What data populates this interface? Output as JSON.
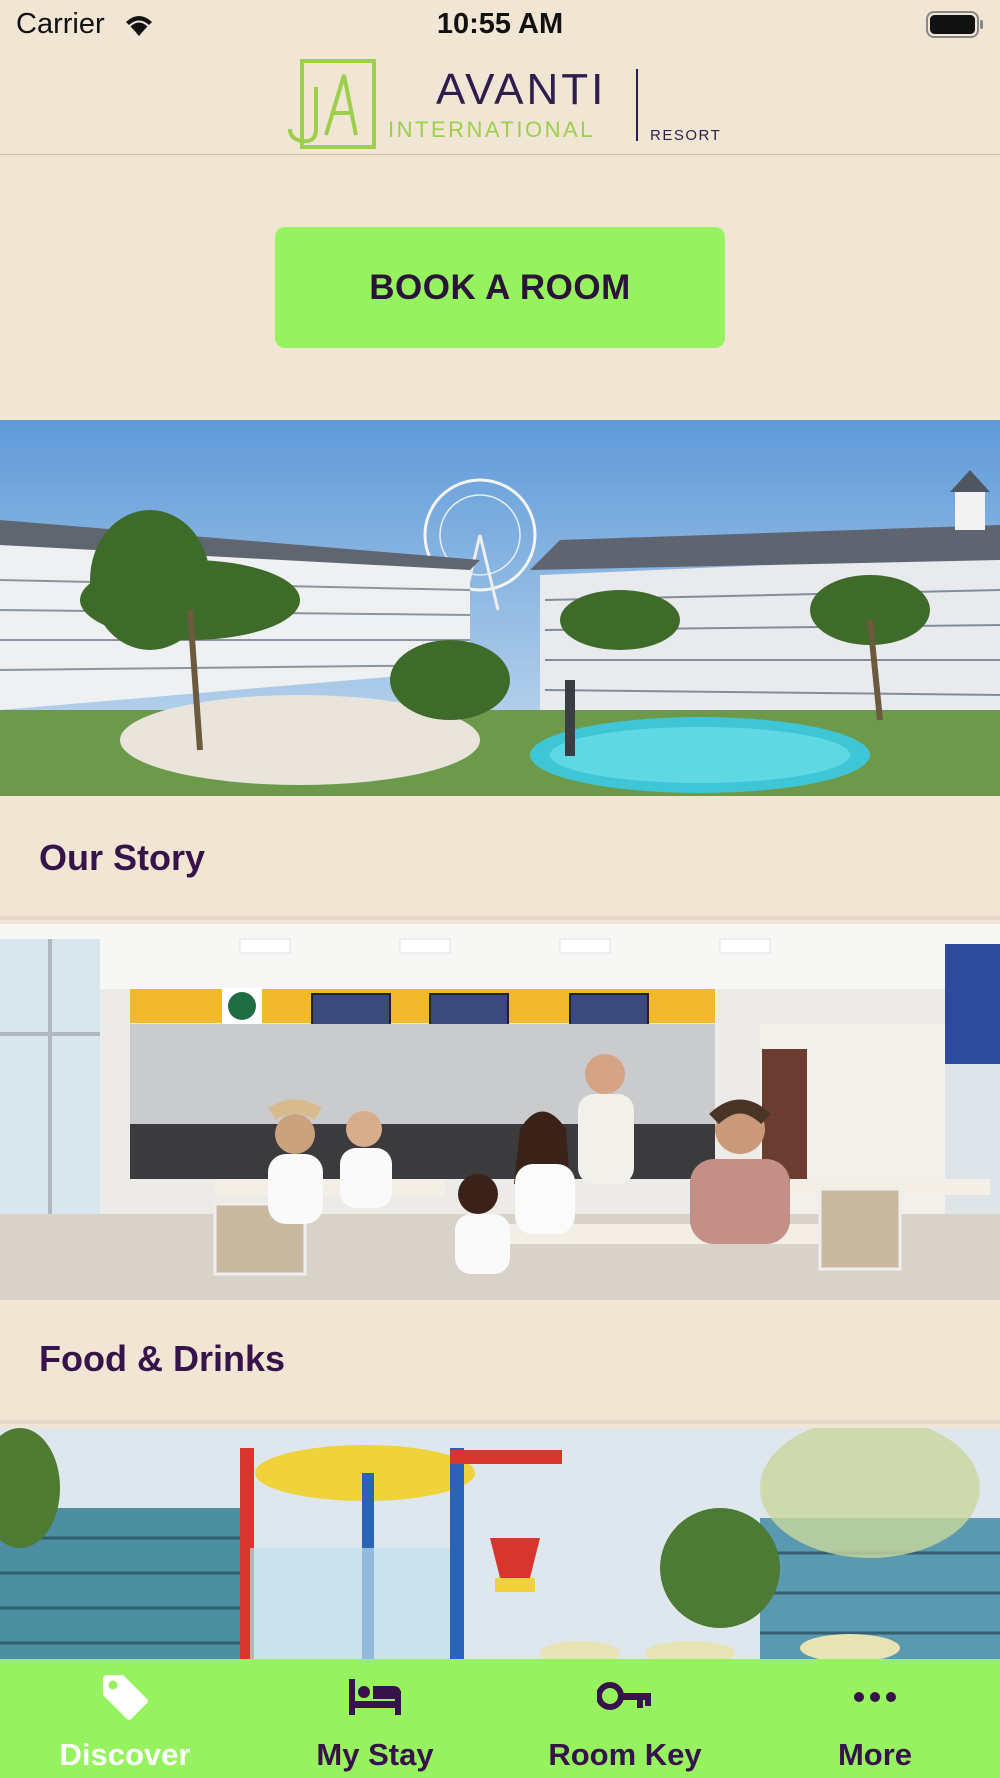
{
  "status_bar": {
    "carrier": "Carrier",
    "time": "10:55 AM"
  },
  "logo": {
    "name": "AVANTI",
    "subtitle": "INTERNATIONAL",
    "tag": "RESORT"
  },
  "book_button": {
    "label": "BOOK A ROOM"
  },
  "feed": [
    {
      "title": "Our Story",
      "image": "resort-pool-aerial-photo"
    },
    {
      "title": "Food & Drinks",
      "image": "cafe-dining-family-photo"
    },
    {
      "title": "",
      "image": "water-park-splash-photo"
    }
  ],
  "tabbar": {
    "items": [
      {
        "label": "Discover",
        "icon": "tag-icon",
        "active": true
      },
      {
        "label": "My Stay",
        "icon": "bed-icon",
        "active": false
      },
      {
        "label": "Room Key",
        "icon": "key-icon",
        "active": false
      },
      {
        "label": "More",
        "icon": "more-icon",
        "active": false
      }
    ]
  },
  "colors": {
    "background": "#f1e5d4",
    "accent": "#96f25f",
    "brand_purple": "#36144a",
    "logo_green": "#9bcf4c"
  }
}
